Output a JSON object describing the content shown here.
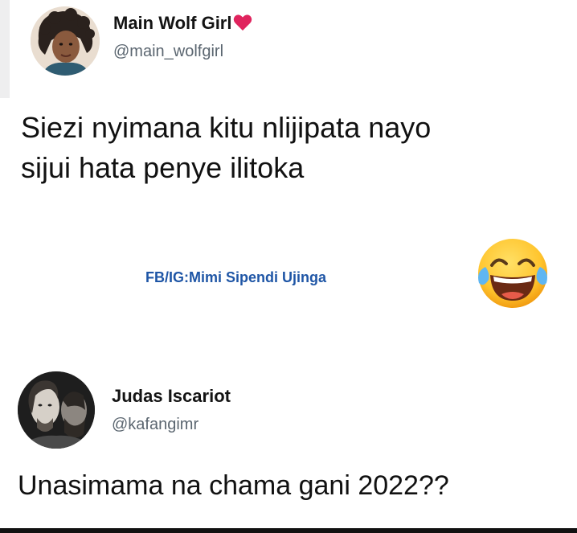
{
  "tweet_1": {
    "display_name": "Main Wolf Girl",
    "handle": "@main_wolfgirl",
    "text_line_1": "Siezi nyimana kitu nlijipata nayo",
    "text_line_2": "sijui hata penye ilitoka",
    "name_emoji": "red-heart-icon"
  },
  "watermark": "FB/IG:Mimi Sipendi Ujinga",
  "reaction_emoji": "face-with-tears-of-joy-icon",
  "tweet_2": {
    "display_name": "Judas Iscariot",
    "handle": "@kafangimr",
    "text": "Unasimama na chama gani 2022??"
  },
  "colors": {
    "background": "#ffffff",
    "text": "#111111",
    "handle": "#5b6670",
    "watermark": "#1f56a6",
    "heart": "#e0245e",
    "emoji_face": "#ffcc33"
  }
}
